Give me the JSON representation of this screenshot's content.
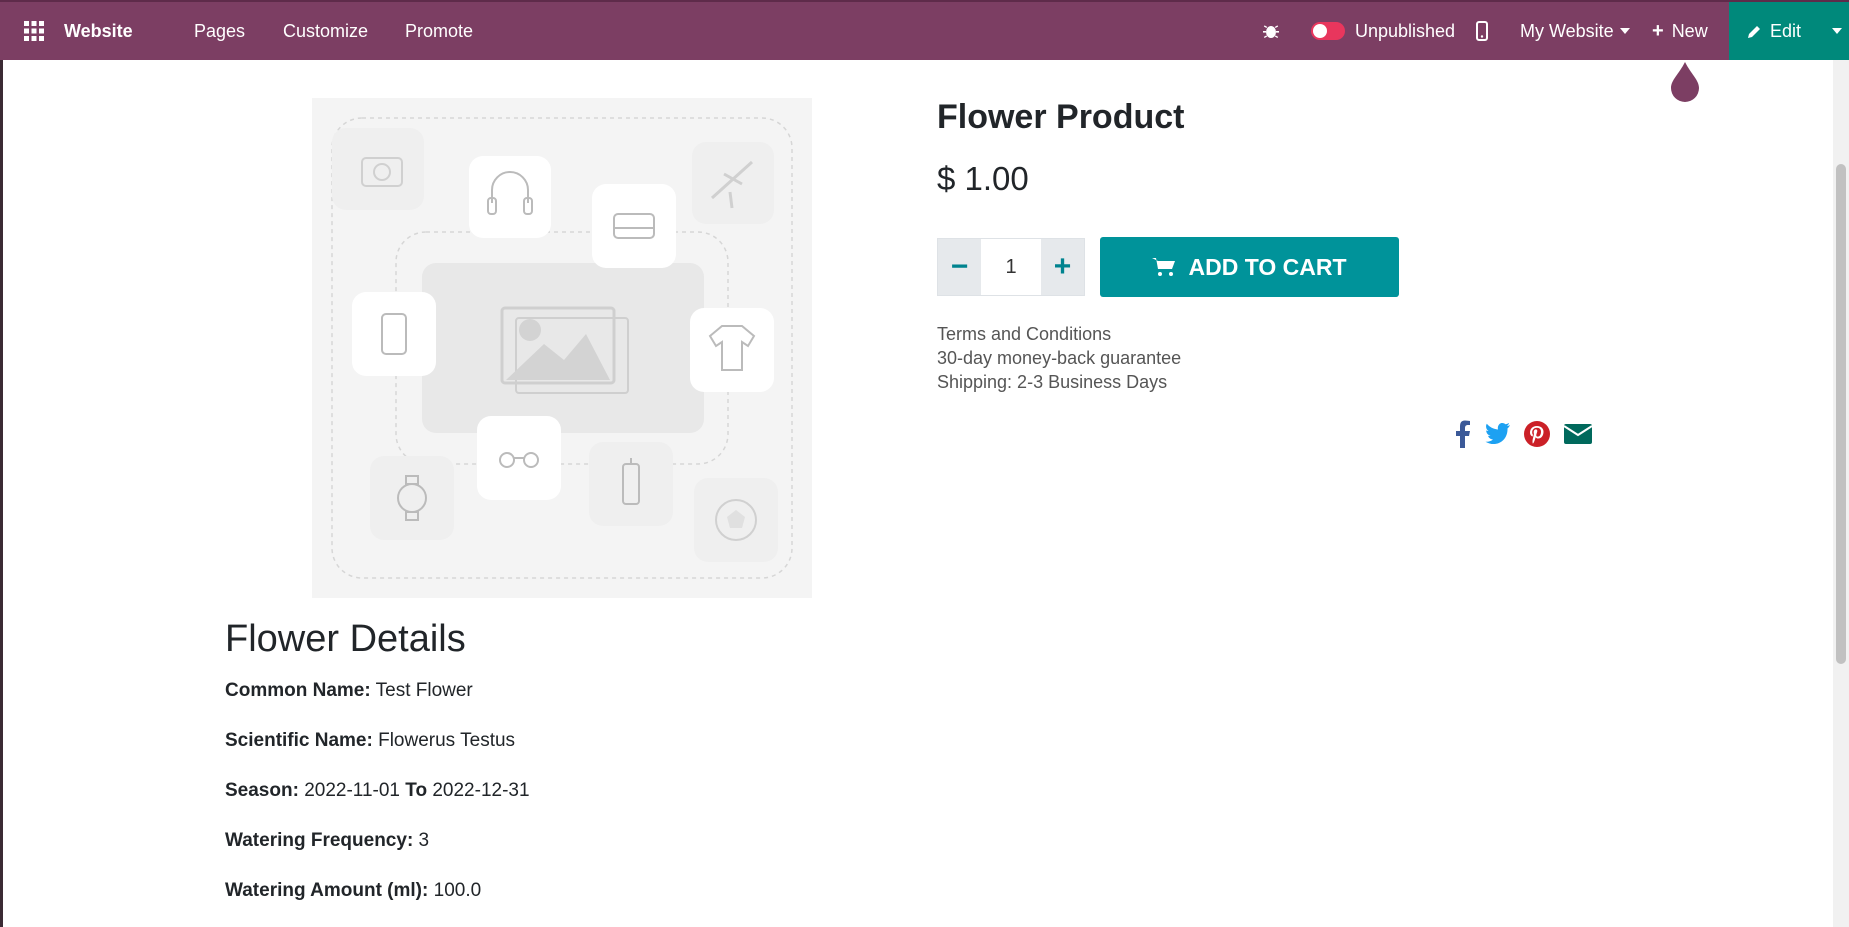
{
  "topbar": {
    "brand": "Website",
    "nav": [
      "Pages",
      "Customize",
      "Promote"
    ],
    "publish_status": "Unpublished",
    "website_selector": "My Website",
    "new_label": "New",
    "edit_label": "Edit",
    "colors": {
      "bar": "#7c3e63",
      "edit": "#00897b"
    }
  },
  "product": {
    "name": "Flower Product",
    "price": "$ 1.00",
    "quantity": "1",
    "add_to_cart": "ADD TO CART",
    "terms": [
      "Terms and Conditions",
      "30-day money-back guarantee",
      "Shipping: 2-3 Business Days"
    ],
    "share_icons": [
      "facebook-icon",
      "twitter-icon",
      "pinterest-icon",
      "email-icon"
    ],
    "colors": {
      "accent": "#00939a"
    }
  },
  "details": {
    "title": "Flower Details",
    "rows": [
      {
        "label": "Common Name:",
        "value": "Test Flower"
      },
      {
        "label": "Scientific Name:",
        "value": "Flowerus Testus"
      },
      {
        "label": "Season:",
        "value": "2022-11-01",
        "label2": "To",
        "value2": "2022-12-31"
      },
      {
        "label": "Watering Frequency:",
        "value": "3"
      },
      {
        "label": "Watering Amount (ml):",
        "value": "100.0"
      }
    ]
  }
}
